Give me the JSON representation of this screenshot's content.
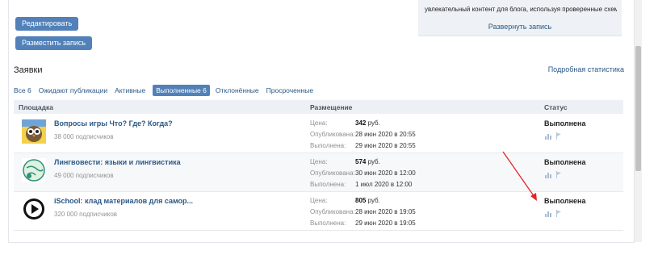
{
  "actions": {
    "edit_label": "Редактировать",
    "post_label": "Разместить запись"
  },
  "preview": {
    "text": "увлекательный контент для блога, используя проверенные схемы и",
    "expand_label": "Развернуть запись"
  },
  "section": {
    "title": "Заявки",
    "stats_link": "Подробная статистика"
  },
  "tabs": [
    {
      "label": "Все 6"
    },
    {
      "label": "Ожидают публикации"
    },
    {
      "label": "Активные"
    },
    {
      "label": "Выполненные 6",
      "active": true
    },
    {
      "label": "Отклонённые"
    },
    {
      "label": "Просроченные"
    }
  ],
  "table": {
    "headers": [
      "Площадка",
      "Размещение",
      "Статус"
    ],
    "detail_labels": {
      "price": "Цена:",
      "published": "Опубликована:",
      "completed": "Выполнена:"
    },
    "rows": [
      {
        "name": "Вопросы игры Что? Где? Когда?",
        "subscribers": "38 000 подписчиков",
        "price": "342",
        "currency": " руб.",
        "published": "28 июн 2020 в 20:55",
        "completed": "29 июн 2020 в 20:55",
        "status": "Выполнена",
        "avatar_icon": "owl-avatar-icon"
      },
      {
        "name": "Лингвовести: языки и лингвистика",
        "subscribers": "49 000 подписчиков",
        "price": "574",
        "currency": " руб.",
        "published": "30 июн 2020 в 12:00",
        "completed": "1 июл 2020 в 12:00",
        "status": "Выполнена",
        "avatar_icon": "globe-avatar-icon"
      },
      {
        "name": "iSchool: клад материалов для самор...",
        "subscribers": "320 000 подписчиков",
        "price": "805",
        "currency": " руб.",
        "published": "28 июн 2020 в 19:05",
        "completed": "29 июн 2020 в 19:05",
        "status": "Выполнена",
        "avatar_icon": "play-avatar-icon"
      }
    ]
  },
  "colors": {
    "accent": "#5181b8",
    "link": "#2a5885",
    "annotation_arrow": "#e0262b"
  }
}
